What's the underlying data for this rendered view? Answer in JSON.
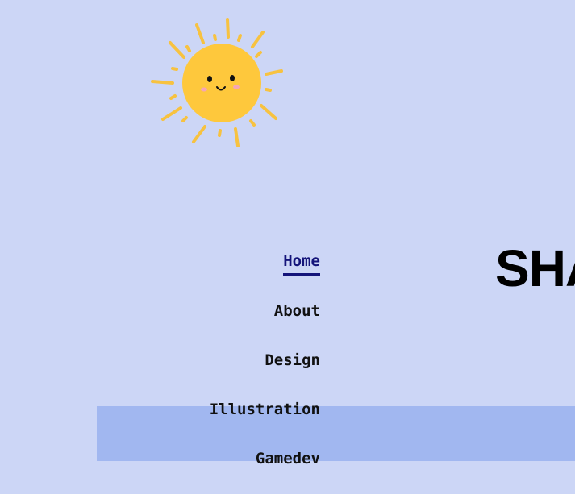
{
  "logo": {
    "icon": "smiling-sun-icon"
  },
  "nav": {
    "items": [
      {
        "label": "Home",
        "active": true
      },
      {
        "label": "About",
        "active": false
      },
      {
        "label": "Design",
        "active": false
      },
      {
        "label": "Illustration",
        "active": false
      },
      {
        "label": "Gamedev",
        "active": false
      }
    ]
  },
  "hero": {
    "title": "SHA"
  },
  "colors": {
    "background": "#ccd6f6",
    "band": "#a1b7f0",
    "active_link": "#14147a",
    "sun": "#fec83c",
    "sun_rays": "#f7c240",
    "cheeks": "#f6a6b4"
  }
}
